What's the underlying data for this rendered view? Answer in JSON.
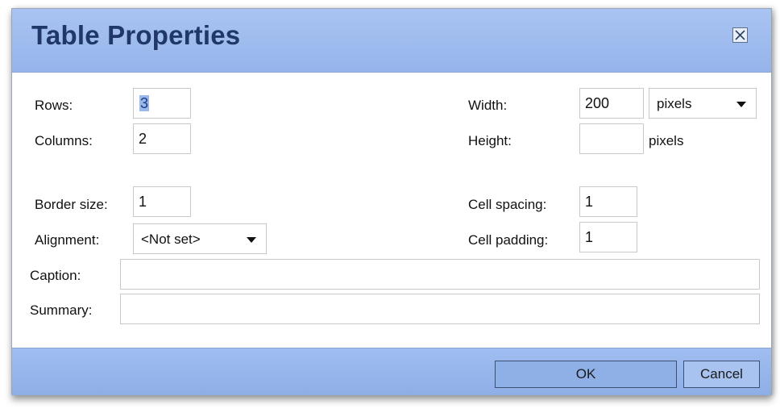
{
  "dialog": {
    "title": "Table Properties",
    "close_icon": "close-icon"
  },
  "fields": {
    "rows": {
      "label": "Rows:",
      "value": "3"
    },
    "columns": {
      "label": "Columns:",
      "value": "2"
    },
    "border_size": {
      "label": "Border size:",
      "value": "1"
    },
    "alignment": {
      "label": "Alignment:",
      "value": "<Not set>"
    },
    "width": {
      "label": "Width:",
      "value": "200",
      "unit": "pixels"
    },
    "height": {
      "label": "Height:",
      "value": "",
      "unit": "pixels"
    },
    "cell_spacing": {
      "label": "Cell spacing:",
      "value": "1"
    },
    "cell_padding": {
      "label": "Cell padding:",
      "value": "1"
    },
    "caption": {
      "label": "Caption:",
      "value": ""
    },
    "summary": {
      "label": "Summary:",
      "value": ""
    }
  },
  "buttons": {
    "ok": "OK",
    "cancel": "Cancel"
  },
  "colors": {
    "titlebar": "#a9c4f2",
    "title_text": "#1f3868",
    "footer": "#9fbdf0"
  }
}
